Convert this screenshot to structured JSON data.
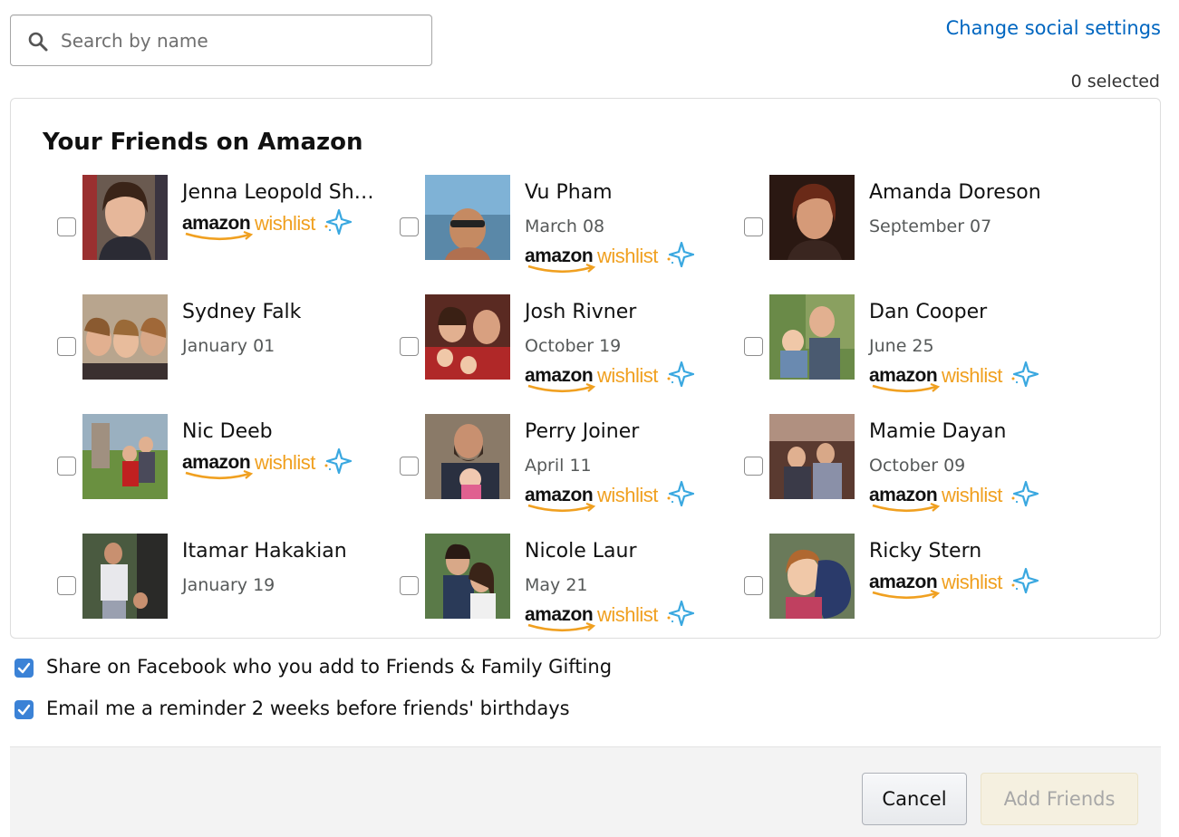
{
  "search": {
    "placeholder": "Search by name",
    "value": ""
  },
  "header": {
    "change_link": "Change social settings",
    "selected_count": "0 selected"
  },
  "panel": {
    "title": "Your Friends on Amazon"
  },
  "wishlist_logo": {
    "amazon": "amazon",
    "wishlist": "wishlist"
  },
  "friends": [
    {
      "name": "Jenna Leopold Sh…",
      "date": "",
      "wishlist": true
    },
    {
      "name": "Vu Pham",
      "date": "March 08",
      "wishlist": true
    },
    {
      "name": "Amanda Doreson",
      "date": "September 07",
      "wishlist": false
    },
    {
      "name": "Sydney Falk",
      "date": "January 01",
      "wishlist": false
    },
    {
      "name": "Josh Rivner",
      "date": "October 19",
      "wishlist": true
    },
    {
      "name": "Dan Cooper",
      "date": "June 25",
      "wishlist": true
    },
    {
      "name": "Nic Deeb",
      "date": "",
      "wishlist": true
    },
    {
      "name": "Perry Joiner",
      "date": "April 11",
      "wishlist": true
    },
    {
      "name": "Mamie Dayan",
      "date": "October 09",
      "wishlist": true
    },
    {
      "name": "Itamar Hakakian",
      "date": "January 19",
      "wishlist": false
    },
    {
      "name": "Nicole Laur",
      "date": "May 21",
      "wishlist": true
    },
    {
      "name": "Ricky Stern",
      "date": "",
      "wishlist": true
    }
  ],
  "options": [
    {
      "label": "Share on Facebook who you add to Friends & Family Gifting",
      "checked": true
    },
    {
      "label": "Email me a reminder 2 weeks before friends' birthdays",
      "checked": true
    }
  ],
  "footer": {
    "cancel_label": "Cancel",
    "add_label": "Add Friends"
  },
  "colors": {
    "link": "#0066c0",
    "checkbox": "#3b82d6",
    "wishlist_orange": "#f0a020",
    "spark": "#3aa8e0"
  },
  "icons": {
    "search": "search-icon",
    "checkmark": "checkmark-icon",
    "sparkle": "sparkle-icon"
  }
}
